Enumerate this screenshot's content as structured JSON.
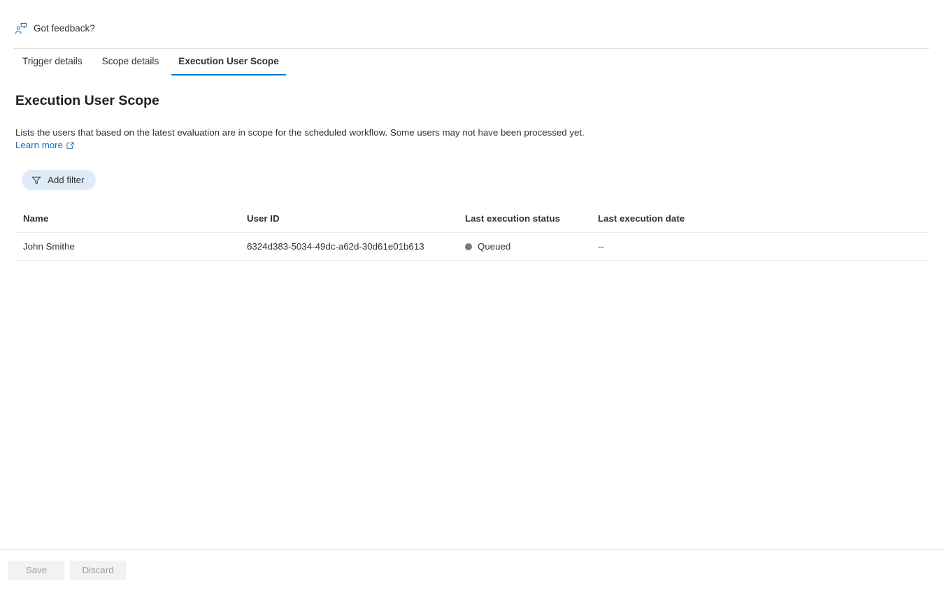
{
  "feedback": {
    "label": "Got feedback?",
    "icon": "feedback-person-icon"
  },
  "tabs": [
    {
      "label": "Trigger details",
      "active": false
    },
    {
      "label": "Scope details",
      "active": false
    },
    {
      "label": "Execution User Scope",
      "active": true
    }
  ],
  "main": {
    "heading": "Execution User Scope",
    "description": "Lists the users that based on the latest evaluation are in scope for the scheduled workflow. Some users may not have been processed yet.",
    "learn_more_label": "Learn more",
    "learn_more_icon": "external-link-icon"
  },
  "toolbar": {
    "add_filter_label": "Add filter",
    "filter_icon": "funnel-icon"
  },
  "table": {
    "columns": [
      "Name",
      "User ID",
      "Last execution status",
      "Last execution date"
    ],
    "rows": [
      {
        "name": "John Smithe",
        "user_id": "6324d383-5034-49dc-a62d-30d61e01b613",
        "status": "Queued",
        "status_color": "#74797e",
        "date": "--"
      }
    ]
  },
  "footer": {
    "save_label": "Save",
    "discard_label": "Discard"
  },
  "colors": {
    "accent": "#0078d4",
    "link": "#0f6cbd",
    "pill_background": "#deecf9",
    "divider": "#e1dfdd",
    "table_divider": "#edebe9",
    "text": "#323130",
    "disabled_text": "#a19f9d",
    "disabled_button_bg": "#f3f2f1"
  }
}
